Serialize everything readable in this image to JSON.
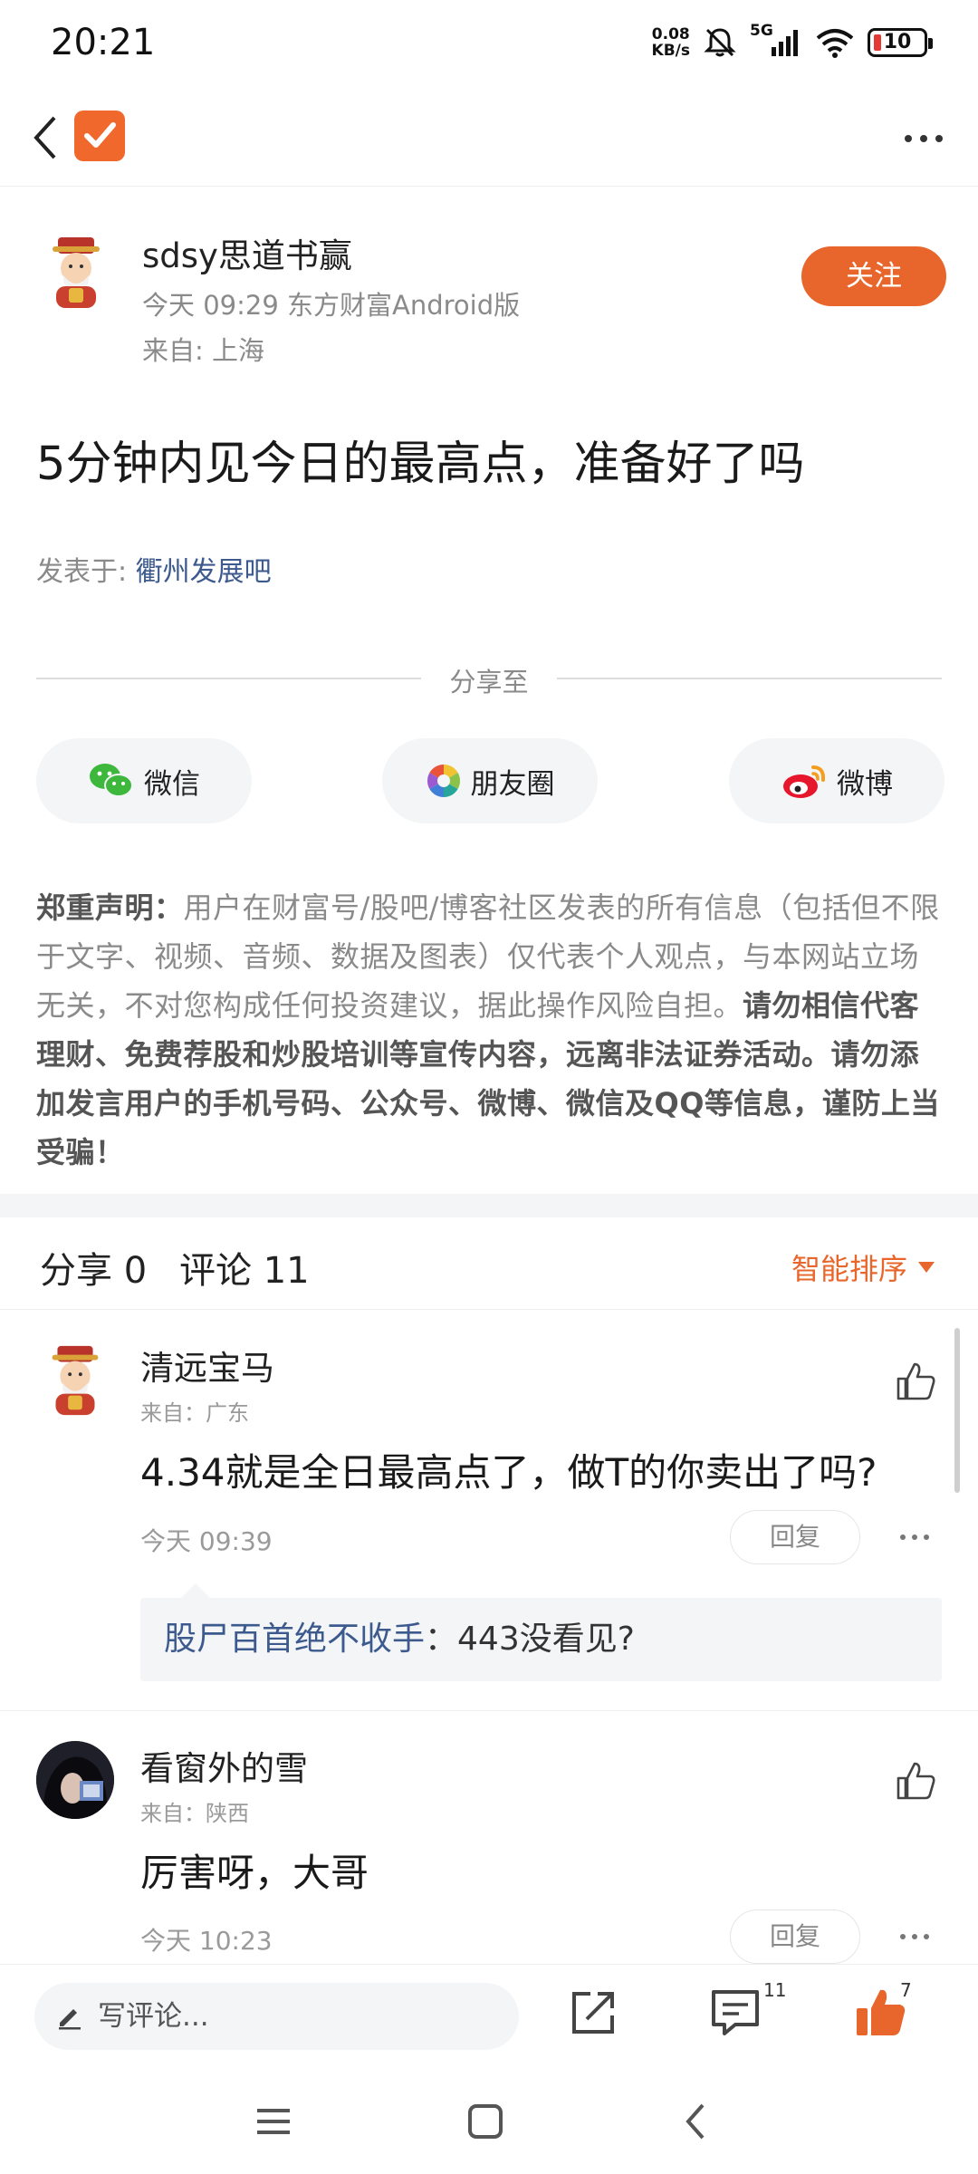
{
  "status_bar": {
    "time": "20:21",
    "net_speed_value": "0.08",
    "net_speed_unit": "KB/s",
    "network": "5G",
    "battery": "10"
  },
  "post": {
    "author": {
      "name": "sdsy思道书赢",
      "meta": "今天 09:29 东方财富Android版",
      "location": "来自: 上海"
    },
    "follow_label": "关注",
    "title": "5分钟内见今日的最高点，准备好了吗",
    "posted_in_label": "发表于: ",
    "forum": "衢州发展吧"
  },
  "share": {
    "label": "分享至",
    "wechat": "微信",
    "moments": "朋友圈",
    "weibo": "微博"
  },
  "disclaimer": {
    "heading": "郑重声明：",
    "body": "用户在财富号/股吧/博客社区发表的所有信息（包括但不限于文字、视频、音频、数据及图表）仅代表个人观点，与本网站立场无关，不对您构成任何投资建议，据此操作风险自担。",
    "warning": "请勿相信代客理财、免费荐股和炒股培训等宣传内容，远离非法证券活动。请勿添加发言用户的手机号码、公众号、微博、微信及QQ等信息，谨防上当受骗！"
  },
  "comments_header": {
    "share_count": "分享 0",
    "comment_count": "评论 11",
    "sort_label": "智能排序"
  },
  "comments": [
    {
      "name": "清远宝马",
      "location": "来自：广东",
      "text": "4.34就是全日最高点了，做T的你卖出了吗?",
      "time": "今天 09:39",
      "reply_label": "回复",
      "sub_reply_user": "股尸百首绝不收手",
      "sub_reply_text": "：443没看见?"
    },
    {
      "name": "看窗外的雪",
      "location": "来自：陕西",
      "text": "厉害呀，大哥",
      "time": "今天 10:23",
      "reply_label": "回复"
    }
  ],
  "bottom_bar": {
    "comment_placeholder": "写评论...",
    "comment_badge": "11",
    "like_badge": "7"
  },
  "colors": {
    "accent": "#e8652b",
    "link": "#3c5a8e"
  }
}
